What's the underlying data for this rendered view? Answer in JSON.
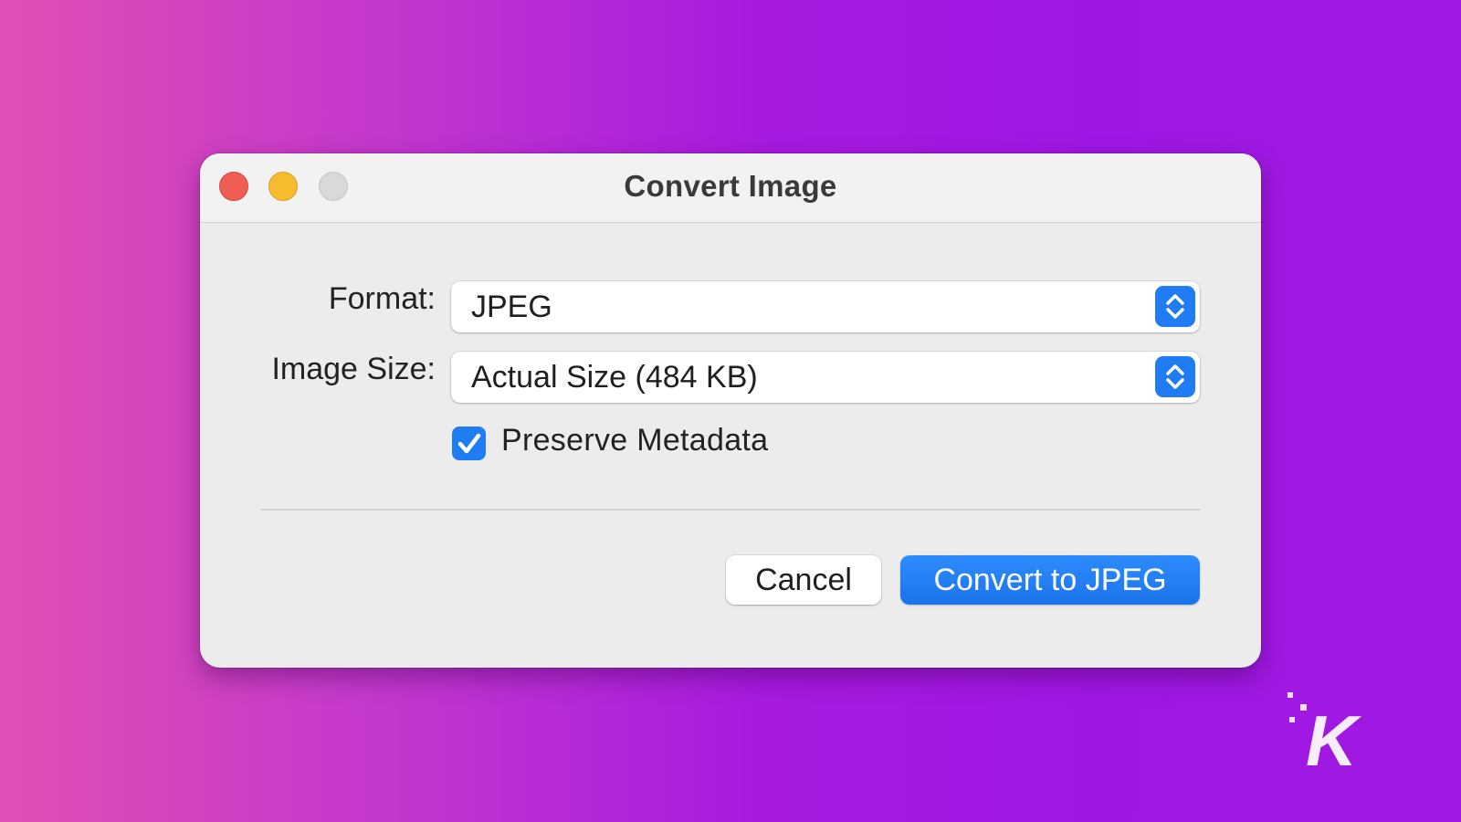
{
  "window": {
    "title": "Convert Image"
  },
  "form": {
    "format_label": "Format:",
    "format_value": "JPEG",
    "size_label": "Image Size:",
    "size_value": "Actual Size (484 KB)",
    "preserve_metadata_label": "Preserve Metadata",
    "preserve_metadata_checked": true
  },
  "buttons": {
    "cancel_label": "Cancel",
    "convert_label": "Convert to JPEG"
  },
  "watermark": {
    "text": "K"
  },
  "colors": {
    "accent": "#1f7cf2",
    "close": "#ef5d55",
    "minimize": "#f6bb2f",
    "zoom": "#d9d9db",
    "background_start": "#df4fb4",
    "background_end": "#9f1ae2"
  }
}
